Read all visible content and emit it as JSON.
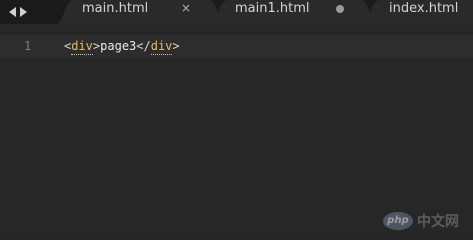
{
  "tabs": [
    {
      "label": "main.html",
      "state": "active-close"
    },
    {
      "label": "main1.html",
      "state": "modified"
    },
    {
      "label": "index.html",
      "state": "normal"
    }
  ],
  "tab_close_glyph": "×",
  "editor": {
    "line_number": "1",
    "code": {
      "open_lt": "<",
      "open_tag": "div",
      "open_gt": ">",
      "text": "page3",
      "close_lt": "</",
      "close_tag": "div",
      "close_gt": ">"
    }
  },
  "watermark": {
    "logo_text": "php",
    "text": "中文网"
  },
  "colors": {
    "background": "#272727",
    "tabbar": "#1a1a1a",
    "tag": "#e8b96d",
    "text": "#ececec"
  }
}
